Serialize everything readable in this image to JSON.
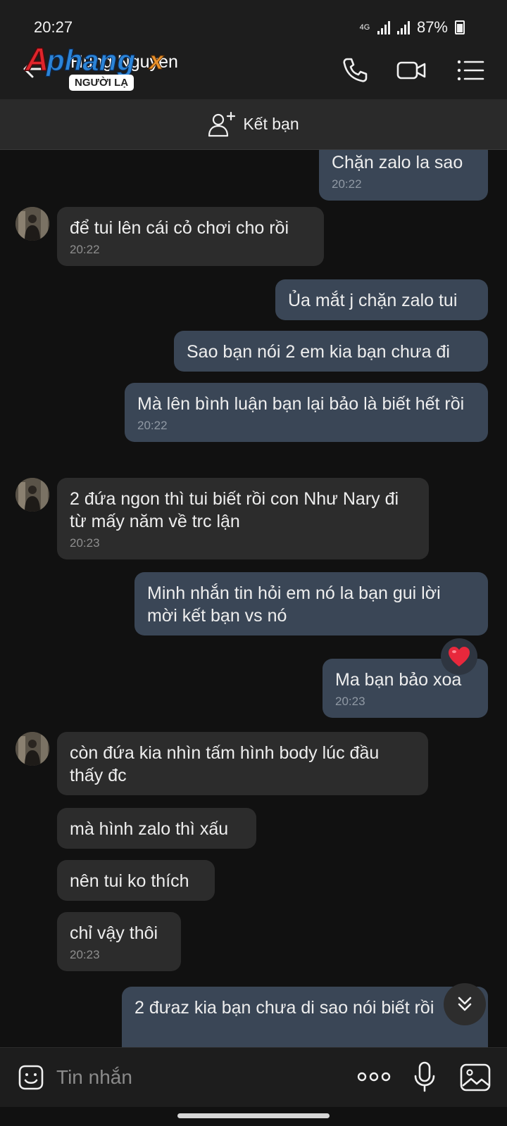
{
  "status_bar": {
    "time": "20:27",
    "network": "4G",
    "battery": "87%"
  },
  "header": {
    "contact_name": "Hung Nguyen",
    "badge": "NGƯỜI LẠ",
    "logo_text": "Aphangx"
  },
  "friend_bar": {
    "label": "Kết bạn"
  },
  "messages": [
    {
      "text": "Chặn zalo la sao",
      "time": "20:22"
    },
    {
      "text": "để tui lên cái cỏ chơi cho rồi",
      "time": "20:22"
    },
    {
      "text": "Ủa mắt j chặn zalo tui"
    },
    {
      "text": "Sao bạn nói 2 em kia bạn chưa đi"
    },
    {
      "text": "Mà lên bình luận bạn lại bảo là biết hết rồi",
      "time": "20:22"
    },
    {
      "text": "2 đứa ngon thì tui biết rồi con Như Nary đi từ mấy năm về trc lận",
      "time": "20:23"
    },
    {
      "text": "Minh nhắn tin hỏi em nó la bạn gui lời mời kết bạn vs nó"
    },
    {
      "text": "Ma bạn bảo xoa",
      "time": "20:23"
    },
    {
      "text": "còn đứa kia nhìn tấm hình body lúc đầu thấy đc"
    },
    {
      "text": "mà hình zalo thì xấu"
    },
    {
      "text": "nên tui ko thích"
    },
    {
      "text": "chỉ vậy thôi",
      "time": "20:23"
    },
    {
      "text": "2 đưaz kia bạn chưa di sao nói biết rồi"
    }
  ],
  "input": {
    "placeholder": "Tin nhắn"
  },
  "colors": {
    "sent_bubble": "#3a4656",
    "received_bubble": "#2c2c2c",
    "background": "#111111",
    "heart": "#e8283c"
  }
}
